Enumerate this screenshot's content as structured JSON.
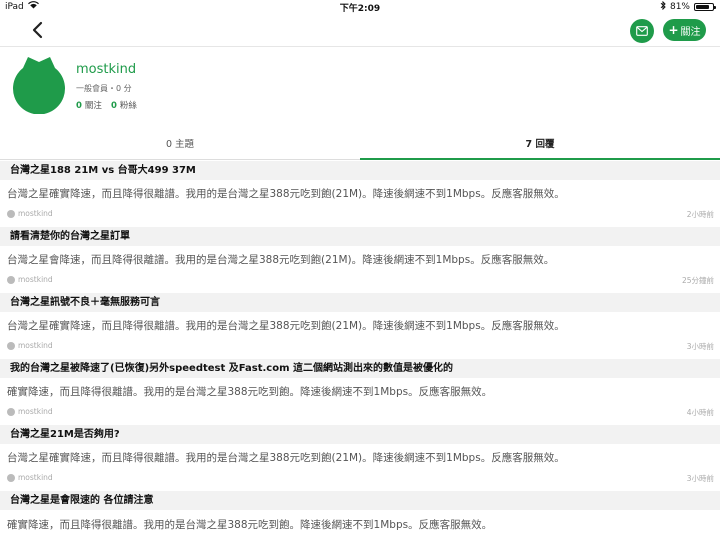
{
  "status_bar": {
    "device": "iPad",
    "time": "下午2:09",
    "battery": "81%",
    "battery_level": 0.81
  },
  "nav": {
    "icons": {
      "back": "chevron-left-icon",
      "mail": "mail-icon"
    },
    "follow_label": "關注",
    "follow_plus": "+"
  },
  "profile": {
    "username": "mostkind",
    "meta": "一般會員・0 分",
    "following_count": "0",
    "following_label": "關注",
    "followers_count": "0",
    "followers_label": "粉絲"
  },
  "tabs": [
    {
      "label": "0 主題",
      "active": false
    },
    {
      "label": "7 回覆",
      "active": true
    }
  ],
  "replies": [
    {
      "title": "台灣之星188 21M vs 台哥大499 37M",
      "body": "台灣之星確實降速，而且降得很離譜。我用的是台灣之星388元吃到飽(21M)。降速後網速不到1Mbps。反應客服無效。",
      "author": "mostkind",
      "time": "2小時前"
    },
    {
      "title": "請看清楚你的台灣之星訂單",
      "body": "台灣之星會降速，而且降得很離譜。我用的是台灣之星388元吃到飽(21M)。降速後網速不到1Mbps。反應客服無效。",
      "author": "mostkind",
      "time": "25分鐘前"
    },
    {
      "title": "台灣之星訊號不良＋毫無服務可言",
      "body": "台灣之星確實降速，而且降得很離譜。我用的是台灣之星388元吃到飽(21M)。降速後網速不到1Mbps。反應客服無效。",
      "author": "mostkind",
      "time": "3小時前"
    },
    {
      "title": "我的台灣之星被降速了(已恢復)另外speedtest 及Fast.com 這二個網站測出來的數值是被優化的",
      "body": "確實降速，而且降得很離譜。我用的是台灣之星388元吃到飽。降速後網速不到1Mbps。反應客服無效。",
      "author": "mostkind",
      "time": "4小時前"
    },
    {
      "title": "台灣之星21M是否夠用?",
      "body": "台灣之星確實降速，而且降得很離譜。我用的是台灣之星388元吃到飽(21M)。降速後網速不到1Mbps。反應客服無效。",
      "author": "mostkind",
      "time": "3小時前"
    },
    {
      "title": "台灣之星是會限速的 各位請注意",
      "body": "確實降速，而且降得很離譜。我用的是台灣之星388元吃到飽。降速後網速不到1Mbps。反應客服無效。",
      "author": "",
      "time": ""
    }
  ],
  "colors": {
    "accent": "#1f9b4a",
    "title_bg": "#f2f2f2"
  }
}
